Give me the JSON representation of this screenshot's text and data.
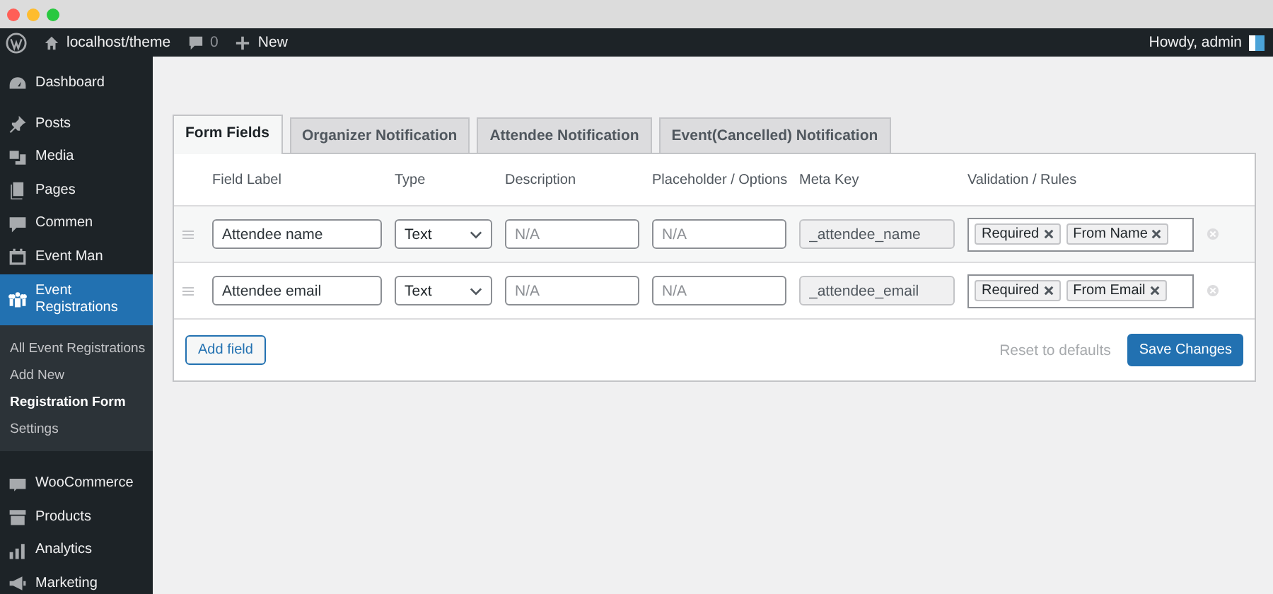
{
  "admin_bar": {
    "site": "localhost/theme",
    "comments": "0",
    "new": "New",
    "greeting": "Howdy, admin"
  },
  "sidebar": {
    "items": [
      {
        "label": "Dashboard",
        "selected": false
      },
      {
        "label": "Posts",
        "selected": false
      },
      {
        "label": "Media",
        "selected": false
      },
      {
        "label": "Pages",
        "selected": false
      },
      {
        "label": "Commen",
        "selected": false
      },
      {
        "label": "Event Man",
        "selected": false
      },
      {
        "label": "Event Registrations",
        "selected": true,
        "children": [
          {
            "label": "All Event Registrations",
            "selected": false
          },
          {
            "label": "Add New",
            "selected": false
          },
          {
            "label": "Registration Form",
            "selected": true
          },
          {
            "label": "Settings",
            "selected": false
          }
        ]
      },
      {
        "label": "WooCommerce",
        "selected": false
      },
      {
        "label": "Products",
        "selected": false
      },
      {
        "label": "Analytics",
        "selected": false
      },
      {
        "label": "Marketing",
        "selected": false
      }
    ]
  },
  "tabs": [
    {
      "label": "Form Fields",
      "selected": true
    },
    {
      "label": "Organizer Notification",
      "selected": false
    },
    {
      "label": "Attendee Notification",
      "selected": false
    },
    {
      "label": "Event(Cancelled) Notification",
      "selected": false
    }
  ],
  "table": {
    "columns": [
      "Field Label",
      "Type",
      "Description",
      "Placeholder / Options",
      "Meta Key",
      "Validation / Rules"
    ],
    "rows": [
      {
        "label": "Attendee name",
        "type": "Text",
        "description_placeholder": "N/A",
        "options_placeholder": "N/A",
        "meta_key": "_attendee_name",
        "rules": [
          "Required",
          "From Name"
        ]
      },
      {
        "label": "Attendee email",
        "type": "Text",
        "description_placeholder": "N/A",
        "options_placeholder": "N/A",
        "meta_key": "_attendee_email",
        "rules": [
          "Required",
          "From Email"
        ]
      }
    ]
  },
  "actions": {
    "add": "Add field",
    "reset": "Reset to defaults",
    "save": "Save Changes"
  }
}
